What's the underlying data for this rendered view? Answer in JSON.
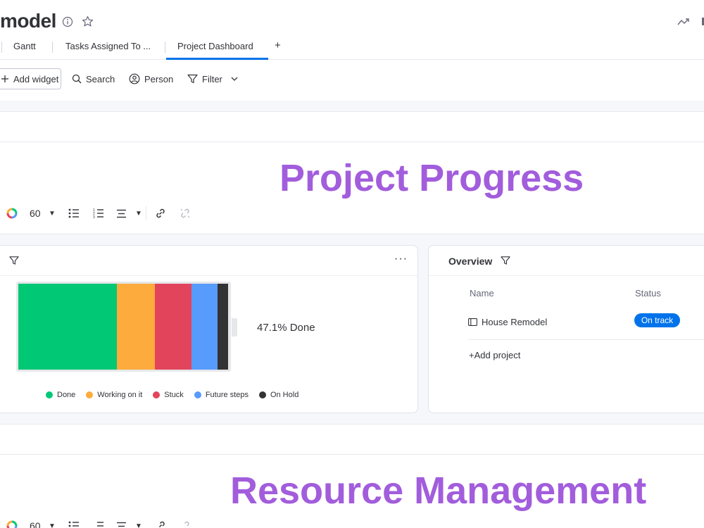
{
  "header": {
    "title": "model",
    "icons": [
      "info-icon",
      "star-icon",
      "activity-icon"
    ],
    "tabs": [
      {
        "label": "Gantt"
      },
      {
        "label": "Tasks Assigned To ..."
      },
      {
        "label": "Project Dashboard",
        "active": true
      },
      {
        "label": "+"
      }
    ]
  },
  "toolbar": {
    "add_widget": "Add widget",
    "search": "Search",
    "person": "Person",
    "filter": "Filter"
  },
  "sections": {
    "progress_heading": "Project Progress",
    "resource_heading": "Resource Management",
    "font_size_value": "60"
  },
  "battery_widget": {
    "percent_label": "47.1% Done",
    "segments": [
      {
        "name": "Done",
        "color": "#00c875",
        "share": 0.469
      },
      {
        "name": "Working on it",
        "color": "#fdab3d",
        "share": 0.181
      },
      {
        "name": "Stuck",
        "color": "#e2445c",
        "share": 0.177
      },
      {
        "name": "Future steps",
        "color": "#579bfc",
        "share": 0.124
      },
      {
        "name": "On Hold",
        "color": "#333333",
        "share": 0.049
      }
    ],
    "legend": [
      "Done",
      "Working on it",
      "Stuck",
      "Future steps",
      "On Hold"
    ]
  },
  "overview_widget": {
    "title": "Overview",
    "columns": {
      "name": "Name",
      "status": "Status"
    },
    "projects": [
      {
        "name": "House Remodel",
        "status": "On track",
        "status_color": "#0073ea"
      }
    ],
    "add_project": "+Add project"
  },
  "colors": {
    "accent": "#0073ea",
    "heading": "#a25ddc"
  }
}
